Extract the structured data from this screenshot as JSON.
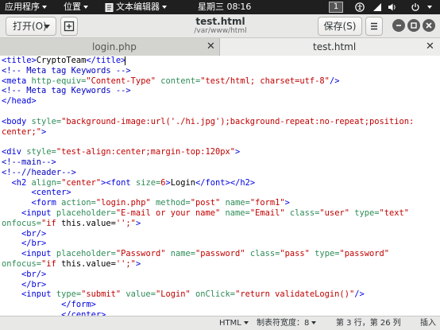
{
  "topbar": {
    "applications": "应用程序",
    "places": "位置",
    "app_name": "文本编辑器",
    "clock": "星期三 08∶16",
    "workspace": "1"
  },
  "header": {
    "open_label": "打开(O)",
    "title": "test.html",
    "subtitle": "/var/www/html",
    "save_label": "保存(S)"
  },
  "tabs": [
    {
      "label": "login.php",
      "active": false
    },
    {
      "label": "test.html",
      "active": true
    }
  ],
  "code_lines": [
    [
      {
        "c": "tg",
        "t": "<title>"
      },
      {
        "c": "tx",
        "t": "CryptoTeam"
      },
      {
        "c": "tg",
        "t": "</title>"
      }
    ],
    [
      {
        "c": "cm",
        "t": "<!-- Meta tag Keywords -->"
      }
    ],
    [
      {
        "c": "tg",
        "t": "<meta "
      },
      {
        "c": "at",
        "t": "http-equiv="
      },
      {
        "c": "st",
        "t": "\"Content-Type\""
      },
      {
        "c": "at",
        "t": " content="
      },
      {
        "c": "st",
        "t": "\"test/html; charset=utf-8\""
      },
      {
        "c": "tg",
        "t": "/>"
      }
    ],
    [
      {
        "c": "cm",
        "t": "<!-- Meta tag Keywords -->"
      }
    ],
    [
      {
        "c": "tg",
        "t": "</head>"
      }
    ],
    [],
    [
      {
        "c": "tg",
        "t": "<body "
      },
      {
        "c": "at",
        "t": "style="
      },
      {
        "c": "st",
        "t": "\"background-image:url('./hi.jpg');background-repeat:no-repeat;position:"
      }
    ],
    [
      {
        "c": "st",
        "t": "center;\""
      },
      {
        "c": "tg",
        "t": ">"
      }
    ],
    [],
    [
      {
        "c": "tg",
        "t": "<div "
      },
      {
        "c": "at",
        "t": "style="
      },
      {
        "c": "st",
        "t": "\"test-align:center;margin-top:120px\""
      },
      {
        "c": "tg",
        "t": ">"
      }
    ],
    [
      {
        "c": "cm",
        "t": "<!--main-->"
      }
    ],
    [
      {
        "c": "cm",
        "t": "<!--//header-->"
      }
    ],
    [
      {
        "c": "tx",
        "t": "  "
      },
      {
        "c": "tg",
        "t": "<h2 "
      },
      {
        "c": "at",
        "t": "align="
      },
      {
        "c": "st",
        "t": "\"center\""
      },
      {
        "c": "tg",
        "t": "><font "
      },
      {
        "c": "at",
        "t": "size="
      },
      {
        "c": "st",
        "t": "6"
      },
      {
        "c": "tg",
        "t": ">"
      },
      {
        "c": "tx",
        "t": "Login"
      },
      {
        "c": "tg",
        "t": "</font></h2>"
      }
    ],
    [
      {
        "c": "tx",
        "t": "      "
      },
      {
        "c": "tg",
        "t": "<center>"
      }
    ],
    [
      {
        "c": "tx",
        "t": "      "
      },
      {
        "c": "tg",
        "t": "<form "
      },
      {
        "c": "at",
        "t": "action="
      },
      {
        "c": "st",
        "t": "\"login.php\""
      },
      {
        "c": "at",
        "t": " method="
      },
      {
        "c": "st",
        "t": "\"post\""
      },
      {
        "c": "at",
        "t": " name="
      },
      {
        "c": "st",
        "t": "\"form1\""
      },
      {
        "c": "tg",
        "t": ">"
      }
    ],
    [
      {
        "c": "tx",
        "t": "    "
      },
      {
        "c": "tg",
        "t": "<input "
      },
      {
        "c": "at",
        "t": "placeholder="
      },
      {
        "c": "st",
        "t": "\"E-mail or your name\""
      },
      {
        "c": "at",
        "t": " name="
      },
      {
        "c": "st",
        "t": "\"Email\""
      },
      {
        "c": "at",
        "t": " class="
      },
      {
        "c": "st",
        "t": "\"user\""
      },
      {
        "c": "at",
        "t": " type="
      },
      {
        "c": "st",
        "t": "\"text\""
      }
    ],
    [
      {
        "c": "at",
        "t": "onfocus="
      },
      {
        "c": "st",
        "t": "\"if "
      },
      {
        "c": "tx",
        "t": "this.value="
      },
      {
        "c": "st",
        "t": "'';\""
      },
      {
        "c": "tg",
        "t": ">"
      }
    ],
    [
      {
        "c": "tx",
        "t": "    "
      },
      {
        "c": "tg",
        "t": "<br/>"
      }
    ],
    [
      {
        "c": "tx",
        "t": "    "
      },
      {
        "c": "tg",
        "t": "</br>"
      }
    ],
    [
      {
        "c": "tx",
        "t": "    "
      },
      {
        "c": "tg",
        "t": "<input "
      },
      {
        "c": "at",
        "t": "placeholder="
      },
      {
        "c": "st",
        "t": "\"Password\""
      },
      {
        "c": "at",
        "t": " name="
      },
      {
        "c": "st",
        "t": "\"password\""
      },
      {
        "c": "at",
        "t": " class="
      },
      {
        "c": "st",
        "t": "\"pass\""
      },
      {
        "c": "at",
        "t": " type="
      },
      {
        "c": "st",
        "t": "\"password\""
      }
    ],
    [
      {
        "c": "at",
        "t": "onfocus="
      },
      {
        "c": "st",
        "t": "\"if "
      },
      {
        "c": "tx",
        "t": "this.value="
      },
      {
        "c": "st",
        "t": "'';\""
      },
      {
        "c": "tg",
        "t": ">"
      }
    ],
    [
      {
        "c": "tx",
        "t": "    "
      },
      {
        "c": "tg",
        "t": "<br/>"
      }
    ],
    [
      {
        "c": "tx",
        "t": "    "
      },
      {
        "c": "tg",
        "t": "</br>"
      }
    ],
    [
      {
        "c": "tx",
        "t": "    "
      },
      {
        "c": "tg",
        "t": "<input "
      },
      {
        "c": "at",
        "t": "type="
      },
      {
        "c": "st",
        "t": "\"submit\""
      },
      {
        "c": "at",
        "t": " value="
      },
      {
        "c": "st",
        "t": "\"Login\""
      },
      {
        "c": "at",
        "t": " onClick="
      },
      {
        "c": "st",
        "t": "\"return validateLogin()\""
      },
      {
        "c": "tg",
        "t": "/>"
      }
    ],
    [
      {
        "c": "tx",
        "t": "            "
      },
      {
        "c": "tg",
        "t": "</form>"
      }
    ],
    [
      {
        "c": "tx",
        "t": "            "
      },
      {
        "c": "tg",
        "t": "</center>"
      }
    ]
  ],
  "status": {
    "language": "HTML",
    "tab_width": "制表符宽度：8",
    "position": "第 3 行，第 26 列",
    "mode": "插入"
  },
  "colors": {
    "tag": "#0000e0",
    "attribute": "#2e8b57",
    "string": "#c00000",
    "comment": "#0000c0"
  }
}
